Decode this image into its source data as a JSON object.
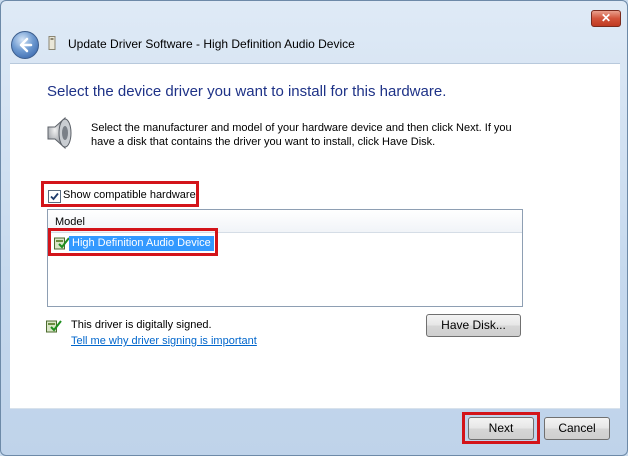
{
  "window": {
    "title": "Update Driver Software - High Definition Audio Device",
    "close_symbol": "✕",
    "back_icon": "back-arrow-icon"
  },
  "main": {
    "heading": "Select the device driver you want to install for this hardware.",
    "description": "Select the manufacturer and model of your hardware device and then click Next. If you have a disk that contains the driver you want to install, click Have Disk.",
    "show_compatible_label": "Show compatible hardware",
    "show_compatible_checked": true,
    "list": {
      "column_header": "Model",
      "items": [
        {
          "label": "High Definition Audio Device",
          "selected": true
        }
      ]
    },
    "signed_text": "This driver is digitally signed.",
    "signing_link": "Tell me why driver signing is important",
    "have_disk_label": "Have Disk..."
  },
  "footer": {
    "next_label": "Next",
    "cancel_label": "Cancel"
  },
  "colors": {
    "highlight": "#d3141a",
    "heading": "#1e3287",
    "selection": "#3399ff",
    "link": "#0066cc"
  }
}
